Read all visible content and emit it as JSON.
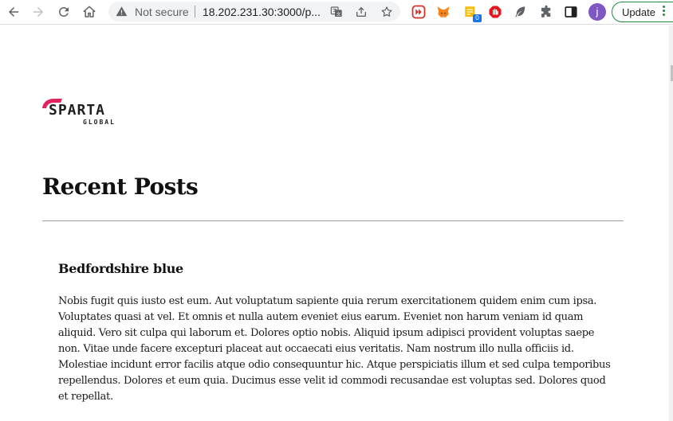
{
  "browser": {
    "security_label": "Not secure",
    "url": "18.202.231.30:3000/p...",
    "extension_badge": "0",
    "profile_initial": "j",
    "update_label": "Update",
    "colors": {
      "update_border": "#1e8e3e",
      "avatar": "#7e57c2"
    }
  },
  "site": {
    "logo_text": "SPARTA",
    "logo_subtext": "GLOBAL",
    "logo_accent_color": "#e0245e"
  },
  "page": {
    "heading": "Recent Posts",
    "posts": [
      {
        "title": "Bedfordshire blue",
        "body": "Nobis fugit quis iusto est eum. Aut voluptatum sapiente quia rerum exercitationem quidem enim cum ipsa. Voluptates quasi at vel. Et omnis et nulla autem eveniet eius earum. Eveniet non harum veniam id quam aliquid. Vero sit culpa qui laborum et. Dolores optio nobis. Aliquid ipsum adipisci provident voluptas saepe non. Vitae unde facere excepturi placeat aut occaecati eius veritatis. Nam nostrum illo nulla officiis id. Molestiae incidunt error facilis atque odio consequuntur hic. Atque perspiciatis illum et sed culpa temporibus repellendus. Dolores et eum quia. Ducimus esse velit id commodi recusandae est voluptas sed. Dolores quod et repellat."
      }
    ]
  }
}
